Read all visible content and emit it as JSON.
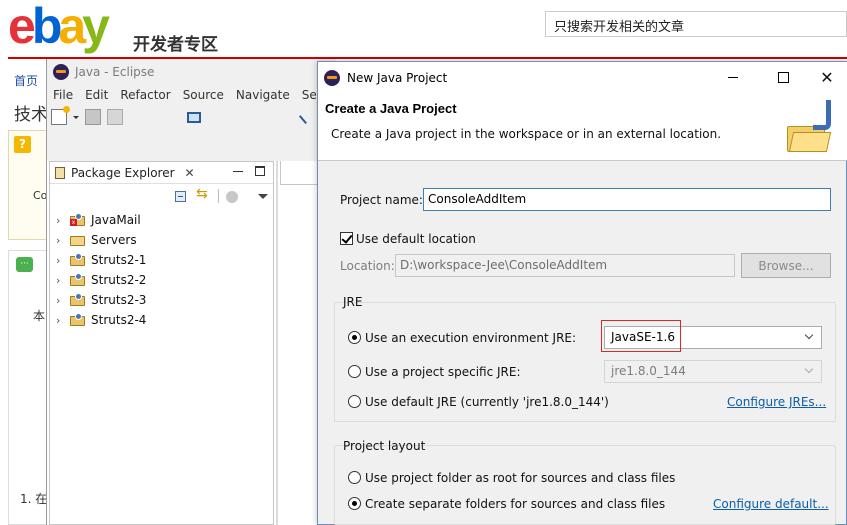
{
  "web": {
    "logo_text": "ebay",
    "logo_letters": [
      "e",
      "b",
      "a",
      "y"
    ],
    "dev_zone": "开发者专区",
    "search_placeholder": "只搜索开发相关的文章",
    "breadcrumb": "首页",
    "tech_heading": "技术",
    "box1_icon_glyph": "?",
    "box1_text": "Co",
    "box2_text": "本",
    "footnote": "1. 在"
  },
  "eclipse": {
    "window_title": "Java - Eclipse",
    "menu": [
      "File",
      "Edit",
      "Refactor",
      "Source",
      "Navigate",
      "Se"
    ],
    "package_explorer": {
      "title": "Package Explorer",
      "close_glyph": "✕",
      "projects": [
        {
          "name": "JavaMail",
          "icon": "java-project-error-icon"
        },
        {
          "name": "Servers",
          "icon": "folder-icon"
        },
        {
          "name": "Struts2-1",
          "icon": "java-project-icon"
        },
        {
          "name": "Struts2-2",
          "icon": "java-project-icon"
        },
        {
          "name": "Struts2-3",
          "icon": "java-project-icon"
        },
        {
          "name": "Struts2-4",
          "icon": "java-project-icon"
        }
      ]
    }
  },
  "dialog": {
    "window_title": "New Java Project",
    "close_glyph": "✕",
    "banner_title": "Create a Java Project",
    "banner_description": "Create a Java project in the workspace or in an external location.",
    "project_name_label": "Project name:",
    "project_name_value": "ConsoleAddItem",
    "use_default_location_label": "Use default location",
    "use_default_location_checked": true,
    "location_label": "Location:",
    "location_value": "D:\\workspace-Jee\\ConsoleAddItem",
    "browse_button": "Browse...",
    "jre_group_label": "JRE",
    "jre_options": [
      {
        "label": "Use an execution environment JRE:",
        "selected": true,
        "value": "JavaSE-1.6"
      },
      {
        "label": "Use a project specific JRE:",
        "selected": false,
        "value": "jre1.8.0_144"
      },
      {
        "label": "Use default JRE (currently 'jre1.8.0_144')",
        "selected": false
      }
    ],
    "configure_jres_link": "Configure JREs...",
    "layout_group_label": "Project layout",
    "layout_options": [
      {
        "label": "Use project folder as root for sources and class files",
        "selected": false
      },
      {
        "label": "Create separate folders for sources and class files",
        "selected": true
      }
    ],
    "configure_default_link": "Configure default..."
  },
  "colors": {
    "ebay_red": "#e53238",
    "ebay_blue": "#0064d2",
    "ebay_yellow": "#f5af02",
    "ebay_green": "#86b817",
    "highlight_red": "#d42a2a",
    "link_blue": "#0b5ea8"
  }
}
